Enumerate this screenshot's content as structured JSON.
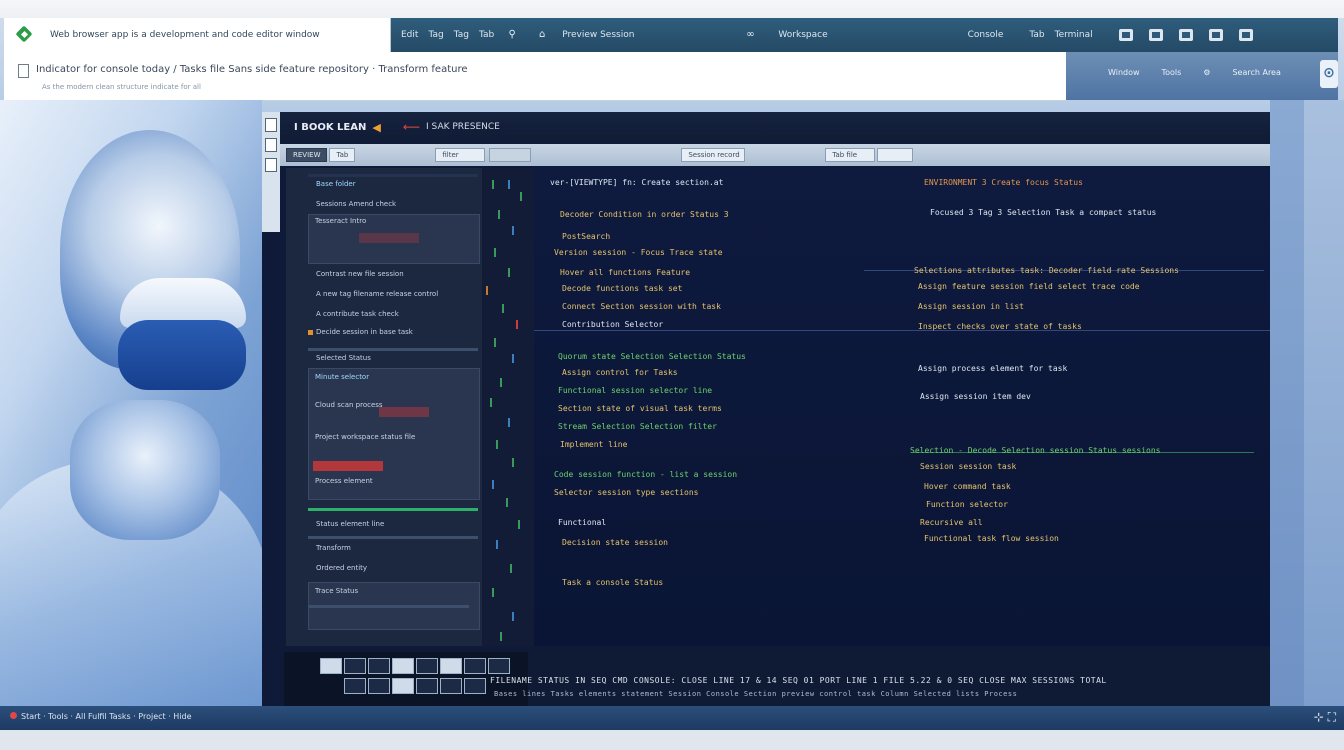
{
  "window": {
    "title": "Web browser app is a development and code editor window",
    "top_items": [
      "Edit",
      "Tag",
      "Tag",
      "Tab",
      "Fi",
      "Preview Session",
      "",
      "Workspace",
      "Console",
      "Tab",
      "Terminal"
    ],
    "path": "Indicator for console today / Tasks file Sans side feature repository  ·  Transform feature",
    "subpath": "As the modern clean structure indicate for all",
    "right_items": [
      "Window",
      "Tools",
      "Search Area"
    ],
    "help_glyph": "⊙"
  },
  "editor": {
    "title": "I BOOK LEAN",
    "breadcrumb": "I SAK PRESENCE",
    "toolbar_left": [
      "REVIEW",
      "Tab"
    ],
    "toolbar_pills": [
      "filter",
      "",
      "Session record",
      "Tab file",
      ""
    ],
    "panel_items": [
      "Base folder",
      "Sessions Amend check",
      "Tesseract Intro",
      "Contrast new file session",
      "A new tag filename release control",
      "A contribute task check",
      "Decide session in base task",
      "Selected Status",
      "Minute selector",
      "Cloud scan process",
      "Project workspace status file",
      "Process element",
      "Status element line",
      "Transform",
      "Ordered entity",
      "Trace Status"
    ],
    "code_left": [
      "ver-[VIEWTYPE] fn: Create section.at",
      "Decoder Condition in order Status  3",
      "PostSearch",
      "Version session - Focus Trace state",
      "Hover all functions Feature",
      "Decode functions task set",
      "Connect Section session with task",
      "Contribution Selector",
      "Quorum state Selection Selection Status",
      "Assign control for Tasks",
      "Functional session selector line",
      "Section state of visual task terms",
      "Stream Selection Selection filter",
      "Implement line",
      "Code session function - list a session",
      "Selector session type sections",
      "Functional",
      "Decision state session",
      "Task a console Status"
    ],
    "code_right": [
      "ENVIRONMENT 3 Create focus Status",
      "Focused 3 Tag 3 Selection Task a compact status",
      "Selections attributes task: Decoder field rate Sessions",
      "Assign feature session field select trace code",
      "Assign session in list",
      "Inspect checks over state of tasks",
      "Assign process element for task",
      "Assign session item dev",
      "Selection - Decode Selection session Status sessions",
      "Session session task",
      "Hover command task",
      "Function selector",
      "Recursive all",
      "Functional task flow session"
    ],
    "status_line": "FILENAME STATUS IN SEQ CMD CONSOLE: CLOSE LINE 17 & 14 SEQ 01 PORT LINE 1 FILE 5.22 & 0 SEQ CLOSE MAX SESSIONS TOTAL",
    "status_line_2": "Bases lines Tasks elements statement Session Console Section preview control task Column Selected lists Process"
  },
  "taskbar": {
    "left": "Start  ·  Tools  ·  All Fulfil Tasks  ·  Project  ·  Hide",
    "right": "⊹ ⛶"
  },
  "colors": {
    "accent_green": "#2c9c48",
    "code_bg": "#0e1a3e",
    "titlebar": "#244a66"
  }
}
